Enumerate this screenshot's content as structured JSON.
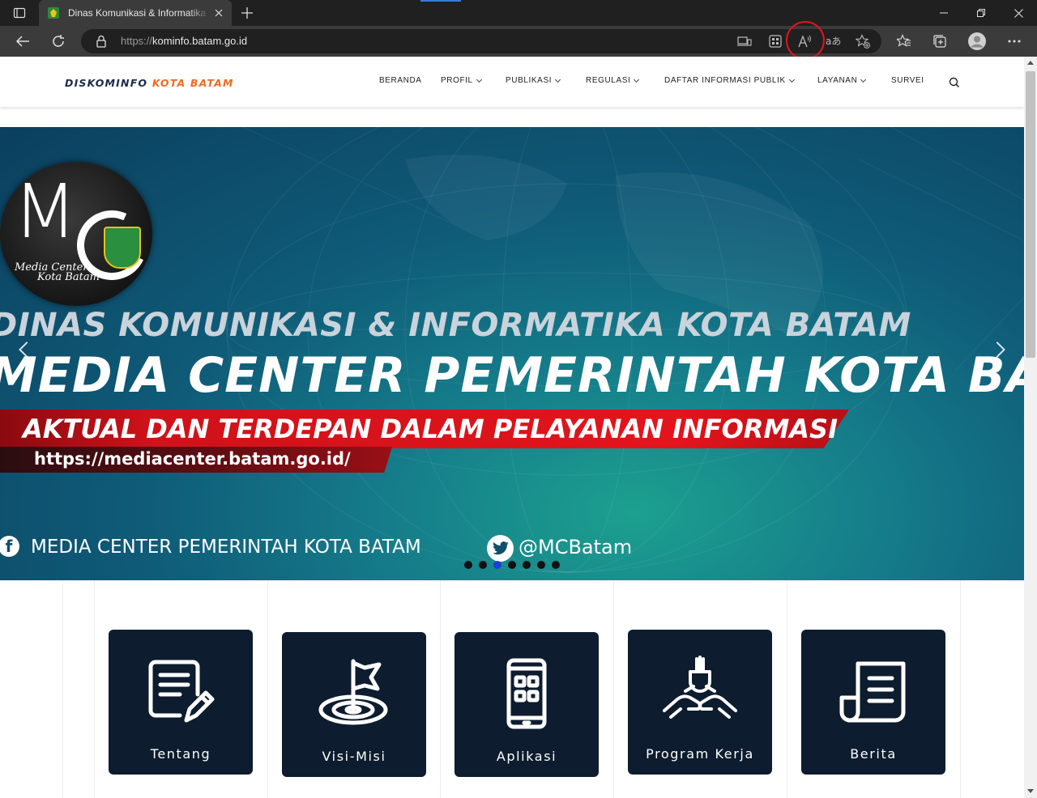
{
  "browser": {
    "tab_title": "Dinas Komunikasi & Informatika",
    "url_scheme": "https://",
    "url_host": "kominfo.batam.go.id"
  },
  "site": {
    "logo_part1": "DISKOMINFO",
    "logo_part2": "KOTA BATAM",
    "menu": [
      {
        "label": "BERANDA",
        "has_dropdown": false
      },
      {
        "label": "PROFIL",
        "has_dropdown": true
      },
      {
        "label": "PUBLIKASI",
        "has_dropdown": true
      },
      {
        "label": "REGULASI",
        "has_dropdown": true
      },
      {
        "label": "DAFTAR INFORMASI PUBLIK",
        "has_dropdown": true
      },
      {
        "label": "LAYANAN",
        "has_dropdown": true
      },
      {
        "label": "SURVEI",
        "has_dropdown": false
      }
    ]
  },
  "hero": {
    "logo_big": "M",
    "logo_line1": "Media Center",
    "logo_line2": "Kota Batam",
    "line1": "DINAS KOMUNIKASI & INFORMATIKA KOTA BATAM",
    "line2": "MEDIA CENTER PEMERINTAH KOTA BATAM",
    "tagline": "AKTUAL DAN TERDEPAN DALAM PELAYANAN INFORMASI",
    "link": "https://mediacenter.batam.go.id/",
    "facebook_icon_glyph": "f",
    "facebook_label": "MEDIA CENTER PEMERINTAH KOTA BATAM",
    "twitter_label": "@MCBatam",
    "slide_count": 7,
    "active_slide": 3
  },
  "cards": [
    {
      "label": "Tentang",
      "icon": "document-edit-icon"
    },
    {
      "label": "Visi-Misi",
      "icon": "target-flag-icon"
    },
    {
      "label": "Aplikasi",
      "icon": "smartphone-apps-icon"
    },
    {
      "label": "Program Kerja",
      "icon": "teamwork-hands-icon"
    },
    {
      "label": "Berita",
      "icon": "newspaper-icon"
    }
  ],
  "colors": {
    "logo_dark": "#1b2a47",
    "logo_orange": "#f26a21",
    "card_bg": "#0d1c2e",
    "tagline_red": "#e3141c",
    "annotation_red": "#e1141e"
  }
}
